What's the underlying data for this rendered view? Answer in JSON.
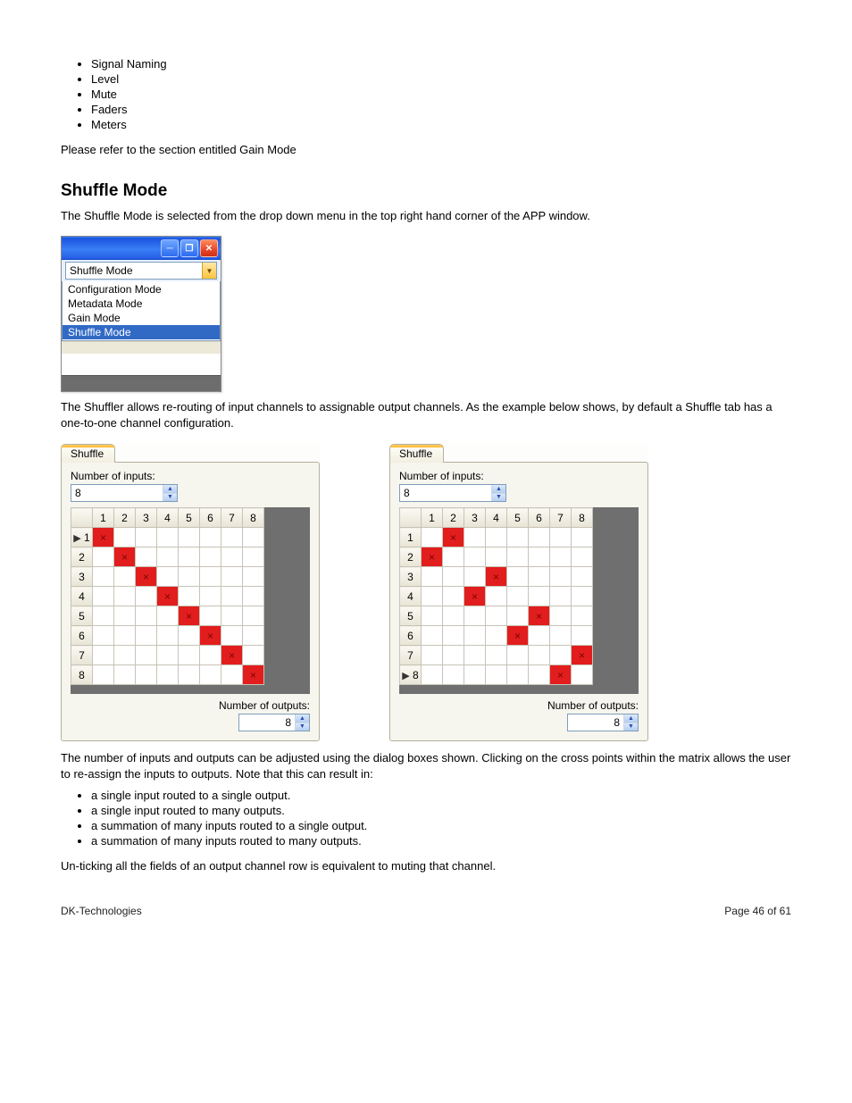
{
  "header_bullets": [
    "Signal Naming",
    "Level",
    "Mute",
    "Faders",
    "Meters"
  ],
  "intro_paragraph": "Please refer to the section entitled Gain Mode",
  "section_title": "Shuffle Mode",
  "para1": "The Shuffle Mode is selected from the drop down menu in the top right hand corner of the APP window.",
  "para2": "The Shuffler allows re-routing of input channels to assignable output channels. As the example below shows, by default a Shuffle tab has a one-to-one channel configuration.",
  "para3": "The number of inputs and outputs can be adjusted using the dialog boxes shown. Clicking on the cross points within the matrix allows the user to re-assign the inputs to outputs. Note that this can result in:",
  "para4": "Un-ticking all the fields of an output channel row is equivalent to muting that channel.",
  "xp": {
    "min_icon": "─",
    "max_icon": "❐",
    "close_icon": "✕",
    "selected": "Shuffle Mode",
    "options": [
      "Configuration Mode",
      "Metadata Mode",
      "Gain Mode",
      "Shuffle Mode"
    ],
    "highlight_index": 3
  },
  "tab_label": "Shuffle",
  "inputs_label": "Number of inputs:",
  "outputs_label": "Number of outputs:",
  "inputs_value": "8",
  "outputs_value": "8",
  "cols": [
    "1",
    "2",
    "3",
    "4",
    "5",
    "6",
    "7",
    "8"
  ],
  "rows": [
    "1",
    "2",
    "3",
    "4",
    "5",
    "6",
    "7",
    "8"
  ],
  "mark_glyph": "×",
  "pointer_glyph": "▶",
  "grid1": {
    "pointer_row": 0,
    "marks": [
      [
        0,
        0
      ],
      [
        1,
        1
      ],
      [
        2,
        2
      ],
      [
        3,
        3
      ],
      [
        4,
        4
      ],
      [
        5,
        5
      ],
      [
        6,
        6
      ],
      [
        7,
        7
      ]
    ]
  },
  "grid2": {
    "pointer_row": 7,
    "marks": [
      [
        0,
        1
      ],
      [
        1,
        0
      ],
      [
        2,
        3
      ],
      [
        3,
        2
      ],
      [
        4,
        5
      ],
      [
        5,
        4
      ],
      [
        6,
        7
      ],
      [
        7,
        6
      ]
    ]
  },
  "result_bullets": [
    "a single input routed to a single output.",
    "a single input routed to many outputs.",
    "a summation of many inputs routed to a single output.",
    "a summation of many inputs routed to many outputs."
  ],
  "footer_left": "DK-Technologies",
  "footer_right": "Page 46 of 61"
}
